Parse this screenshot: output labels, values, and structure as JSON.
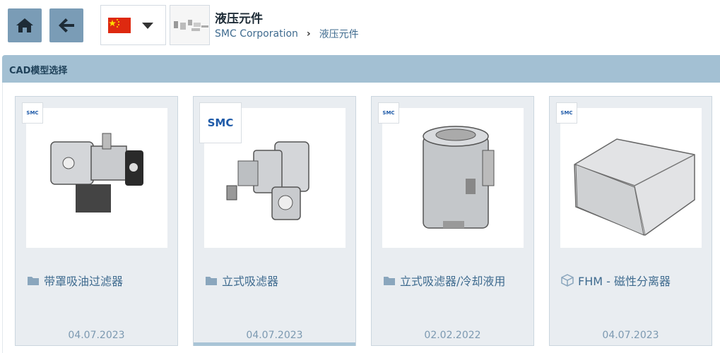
{
  "header": {
    "title": "液压元件",
    "breadcrumb": [
      "SMC Corporation",
      "液压元件"
    ]
  },
  "panel": {
    "title": "CAD模型选择"
  },
  "brand_logo_text": "SMC",
  "cards": [
    {
      "label": "带罩吸油过滤器",
      "date": "04.07.2023",
      "icon": "folder-icon"
    },
    {
      "label": "立式吸滤器",
      "date": "04.07.2023",
      "icon": "folder-icon"
    },
    {
      "label": "立式吸滤器/冷却液用",
      "date": "02.02.2022",
      "icon": "folder-icon"
    },
    {
      "label": "FHM - 磁性分离器",
      "date": "04.07.2023",
      "icon": "cube-icon"
    }
  ],
  "colors": {
    "accent": "#7a9cb6",
    "panel": "#a3c0d3",
    "link": "#3f6b8f"
  }
}
